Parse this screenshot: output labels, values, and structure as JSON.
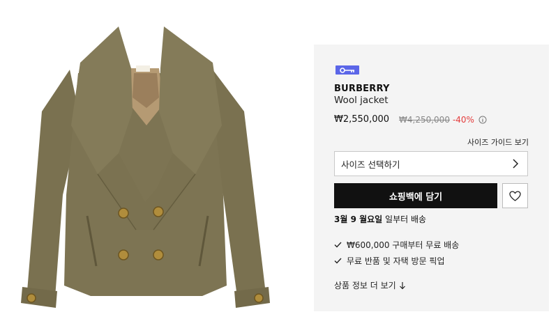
{
  "product": {
    "brand": "BURBERRY",
    "name": "Wool jacket",
    "price_current": "₩2,550,000",
    "price_original": "₩4,250,000",
    "discount": "-40%"
  },
  "size_guide_label": "사이즈 가이드 보기",
  "size_select_label": "사이즈 선택하기",
  "cart_button_label": "쇼핑백에 담기",
  "delivery": {
    "date": "3월 9 월요일",
    "text": " 일부터 배송"
  },
  "benefits": [
    "₩600,000 구매부터 무료 배송",
    "무료 반품 및 자택 방문 픽업"
  ],
  "more_info_label": "상품 정보 더 보기",
  "colors": {
    "jacket": "#7b7251",
    "badge": "#5b66e8",
    "discount": "#e43c3c",
    "button": "#111111",
    "panel": "#f4f4f4"
  },
  "icons": {
    "badge": "key-icon",
    "info": "info-icon",
    "select": "chevron-right-icon",
    "wish": "heart-icon",
    "benefit": "check-icon",
    "more": "arrow-down-icon"
  }
}
